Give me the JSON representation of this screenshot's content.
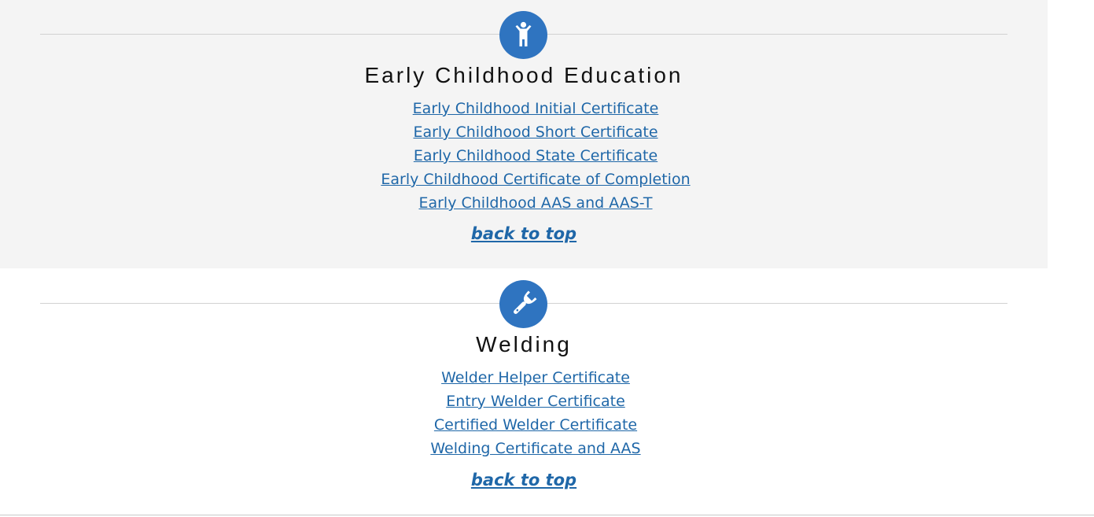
{
  "sections": [
    {
      "icon": "child-icon",
      "title": "Early Childhood Education",
      "links": [
        "Early Childhood Initial Certificate",
        "Early Childhood Short Certificate",
        "Early Childhood State Certificate",
        "Early Childhood Certificate of Completion",
        "Early Childhood AAS and AAS-T"
      ],
      "back_to_top": "back to top",
      "background": "#f4f4f4"
    },
    {
      "icon": "wrench-icon",
      "title": "Welding",
      "links": [
        "Welder Helper Certificate",
        "Entry Welder Certificate",
        "Certified Welder Certificate",
        "Welding Certificate and AAS"
      ],
      "back_to_top": "back to top",
      "background": "#ffffff"
    }
  ],
  "colors": {
    "accent": "#2f74c0",
    "link": "#1f67a8"
  }
}
